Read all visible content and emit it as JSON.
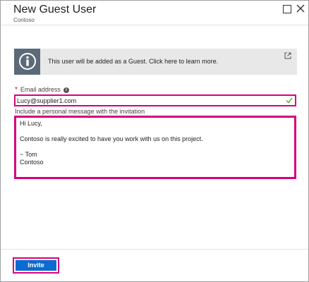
{
  "blade": {
    "title": "New Guest User",
    "subtitle": "Contoso"
  },
  "window_controls": {
    "maximize_icon": "maximize-icon",
    "close_icon": "close-icon"
  },
  "info_banner": {
    "text": "This user will be added as a Guest. Click here to learn more.",
    "icon": "info-icon",
    "external_icon": "external-link-icon"
  },
  "email": {
    "label": "Email address",
    "required_mark": "*",
    "info_icon": "i",
    "value": "Lucy@supplier1.com",
    "valid": true
  },
  "message": {
    "label": "Include a personal message with the invitation",
    "value": "Hi Lucy,\n\nContoso is really excited to have you work with us on this project.\n\n~ Tom\nContoso"
  },
  "actions": {
    "invite_label": "Invite"
  },
  "colors": {
    "highlight": "#d6007e",
    "primary": "#0b6bd0",
    "banner_bg": "#e8e8e8",
    "banner_icon_bg": "#5a6a78"
  }
}
